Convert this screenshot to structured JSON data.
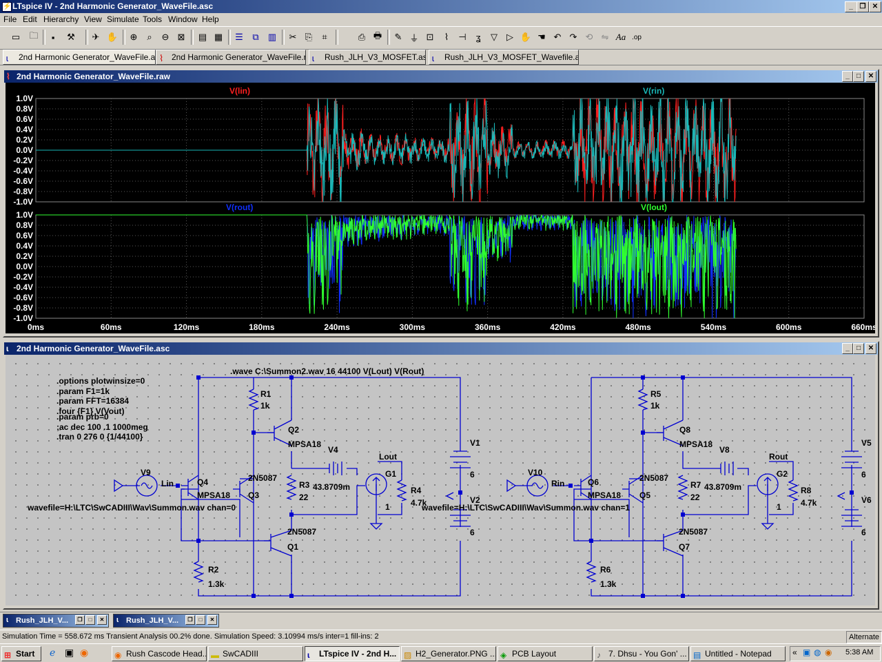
{
  "window": {
    "title": "LTspice IV - 2nd Harmonic Generator_WaveFile.asc"
  },
  "menu": [
    "File",
    "Edit",
    "Hierarchy",
    "View",
    "Simulate",
    "Tools",
    "Window",
    "Help"
  ],
  "toolbar_icons": [
    "new-schematic-icon",
    "open-icon",
    "save-icon",
    "control-panel-icon",
    "run-icon",
    "halt-icon",
    "pan-icon",
    "zoom-in-icon",
    "zoom-pan-icon",
    "zoom-out-icon",
    "zoom-fit-icon",
    "autorange-icon",
    "grid-icon",
    "tile-horizontal-icon",
    "cascade-icon",
    "tile-vertical-icon",
    "cut-icon",
    "copy-icon",
    "find-icon",
    "print-preview-icon",
    "print-icon",
    "draw-wire-icon",
    "ground-icon",
    "label-net-icon",
    "resistor-icon",
    "capacitor-icon",
    "inductor-icon",
    "diode-icon",
    "component-icon",
    "move-icon",
    "drag-icon",
    "undo-icon",
    "redo-icon",
    "rotate-icon",
    "mirror-icon",
    "text-icon",
    "spice-directive-icon"
  ],
  "tabs": [
    {
      "label": "2nd Harmonic Generator_WaveFile.asc",
      "icon": "schematic-icon"
    },
    {
      "label": "2nd Harmonic Generator_WaveFile.raw",
      "icon": "waveform-icon"
    },
    {
      "label": "Rush_JLH_V3_MOSFET.asc",
      "icon": "schematic-icon"
    },
    {
      "label": "Rush_JLH_V3_MOSFET_Wavefile.asc",
      "icon": "schematic-icon"
    }
  ],
  "waveform_window": {
    "title": "2nd Harmonic Generator_WaveFile.raw",
    "pane1": {
      "traces": [
        {
          "name": "V(lin)",
          "color": "#ff2020"
        },
        {
          "name": "V(rin)",
          "color": "#19b8b8"
        }
      ]
    },
    "pane2": {
      "traces": [
        {
          "name": "V(rout)",
          "color": "#1030ff"
        },
        {
          "name": "V(lout)",
          "color": "#30ff30"
        }
      ]
    },
    "y_ticks": [
      "1.0V",
      "0.8V",
      "0.6V",
      "0.4V",
      "0.2V",
      "0.0V",
      "-0.2V",
      "-0.4V",
      "-0.6V",
      "-0.8V",
      "-1.0V"
    ],
    "x_ticks": [
      "0ms",
      "60ms",
      "120ms",
      "180ms",
      "240ms",
      "300ms",
      "360ms",
      "420ms",
      "480ms",
      "540ms",
      "600ms",
      "660ms"
    ]
  },
  "chart_data": [
    {
      "type": "line",
      "title": "",
      "xlabel": "",
      "ylabel": "",
      "xlim": [
        0,
        660
      ],
      "ylim": [
        -1.0,
        1.0
      ],
      "grid": true,
      "series": [
        {
          "name": "V(lin)"
        },
        {
          "name": "V(rin)"
        }
      ],
      "x": [
        0,
        60,
        120,
        180,
        215,
        240,
        260,
        300,
        340,
        360,
        400,
        420,
        430,
        480,
        540,
        558
      ],
      "note_ranges": {
        "silent_ms": [
          0,
          215
        ],
        "active_ms": [
          215,
          558
        ]
      }
    },
    {
      "type": "line",
      "title": "",
      "xlabel": "",
      "ylabel": "",
      "xlim": [
        0,
        660
      ],
      "ylim": [
        -1.0,
        1.0
      ],
      "grid": true,
      "series": [
        {
          "name": "V(rout)"
        },
        {
          "name": "V(lout)"
        }
      ],
      "x": [
        0,
        60,
        120,
        180,
        215,
        240,
        260,
        300,
        340,
        360,
        400,
        420,
        430,
        480,
        540,
        558
      ]
    }
  ],
  "schematic_window": {
    "title": "2nd Harmonic Generator_WaveFile.asc",
    "directives": [
      ".options plotwinsize=0",
      ".param F1=1k",
      ".param FFT=16384",
      ".four {F1} V(Vout)",
      ".param prb=0",
      ";ac dec 100 .1 1000meg",
      ".tran 0 276 0 {1/44100}"
    ],
    "wave_directive": ".wave C:\\Summon2.wav 16 44100 V(Lout) V(Rout)",
    "left": {
      "src": "V9",
      "in": "Lin",
      "wavefile": "wavefile=H:\\LTC\\SwCADIII\\Wav\\Summon.wav chan=0",
      "R1": "R1",
      "R1v": "1k",
      "Q2": "Q2",
      "Q2t": "MPSA18",
      "Q4": "Q4",
      "Q4t": "MPSA18",
      "Q3": "Q3",
      "Q3t": "2N5087",
      "R3": "R3",
      "R3v": "22",
      "Q1": "Q1",
      "Q1t": "2N5087",
      "R2": "R2",
      "R2v": "1.3k",
      "V4": "V4",
      "V4v": "43.8709m",
      "out": "Lout",
      "G1": "G1",
      "G1v": "1",
      "R4": "R4",
      "R4v": "4.7k",
      "V1": "V1",
      "V1v": "6",
      "V2": "V2",
      "V2v": "6"
    },
    "right": {
      "src": "V10",
      "in": "Rin",
      "wavefile": "wavefile=H:\\LTC\\SwCADIII\\Wav\\Summon.wav chan=1",
      "R5": "R5",
      "R5v": "1k",
      "Q8": "Q8",
      "Q8t": "MPSA18",
      "Q6": "Q6",
      "Q6t": "MPSA18",
      "Q5": "Q5",
      "Q5t": "2N5087",
      "R7": "R7",
      "R7v": "22",
      "Q7": "Q7",
      "Q7t": "2N5087",
      "R6": "R6",
      "R6v": "1.3k",
      "V8": "V8",
      "V8v": "43.8709m",
      "out": "Rout",
      "G2": "G2",
      "G2v": "1",
      "R8": "R8",
      "R8v": "4.7k",
      "V5": "V5",
      "V5v": "6",
      "V6": "V6",
      "V6v": "6"
    }
  },
  "minimized": [
    "Rush_JLH_V...",
    "Rush_JLH_V..."
  ],
  "status": {
    "text": "Simulation Time = 558.672 ms  Transient Analysis 00.2% done. Simulation Speed: 3.10994 ms/s inter=1 fill-ins: 2",
    "mode": "Alternate"
  },
  "taskbar": {
    "start": "Start",
    "tasks": [
      {
        "label": "Rush Cascode Head...",
        "icon": "firefox-icon"
      },
      {
        "label": "SwCADIII",
        "icon": "folder-icon"
      },
      {
        "label": "LTspice IV - 2nd H...",
        "icon": "ltspice-icon",
        "active": true
      },
      {
        "label": "H2_Generator.PNG ...",
        "icon": "image-icon"
      },
      {
        "label": "PCB Layout",
        "icon": "pcb-icon"
      },
      {
        "label": "7. Dhsu - You Gon' ...",
        "icon": "media-icon"
      },
      {
        "label": "Untitled - Notepad",
        "icon": "notepad-icon"
      }
    ],
    "clock": "5:38 AM"
  }
}
